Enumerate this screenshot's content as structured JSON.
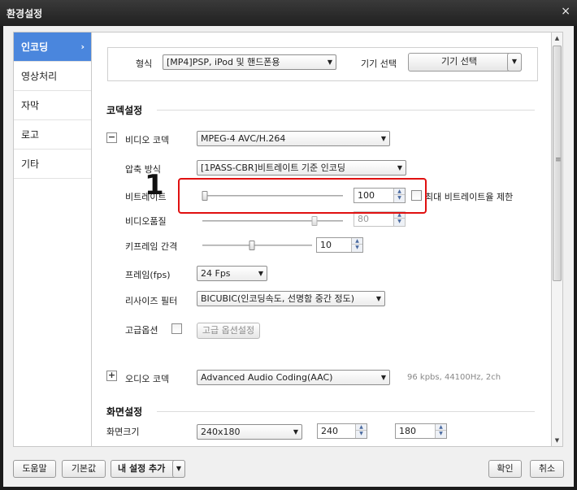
{
  "window": {
    "title": "환경설정",
    "close_glyph": "×"
  },
  "sidebar": {
    "items": [
      {
        "label": "인코딩",
        "active": true,
        "chevron": "›"
      },
      {
        "label": "영상처리"
      },
      {
        "label": "자막"
      },
      {
        "label": "로고"
      },
      {
        "label": "기타"
      }
    ]
  },
  "format": {
    "label": "형식",
    "value": "[MP4]PSP, iPod 및 핸드폰용",
    "device_label": "기기 선택",
    "device_button": "기기 선택"
  },
  "codec": {
    "heading": "코덱설정",
    "video_codec_label": "비디오 코덱",
    "video_codec_value": "MPEG-4 AVC/H.264",
    "compression_label": "압축 방식",
    "compression_value": "[1PASS-CBR]비트레이트 기준 인코딩",
    "bitrate_label": "비트레이트",
    "bitrate_value": "100",
    "bitrate_slider_fraction": 0.02,
    "max_bitrate_label": "최대 비트레이트율 제한",
    "max_bitrate_checked": false,
    "quality_label": "비디오품질",
    "quality_value": "80",
    "quality_slider_fraction": 0.8,
    "keyframe_label": "키프레임 간격",
    "keyframe_value": "10",
    "keyframe_slider_fraction": 0.45,
    "fps_label": "프레임(fps)",
    "fps_value": "24 Fps",
    "resize_label": "리사이즈 필터",
    "resize_value": "BICUBIC(인코딩속도, 선명함 중간 정도)",
    "advanced_label": "고급옵션",
    "advanced_checked": false,
    "advanced_button": "고급 옵션설정",
    "audio_codec_label": "오디오 코덱",
    "audio_codec_value": "Advanced Audio Coding(AAC)",
    "audio_hint": "96 kpbs, 44100Hz, 2ch"
  },
  "screen": {
    "heading": "화면설정",
    "size_label": "화면크기",
    "size_value": "240x180",
    "width_value": "240",
    "height_value": "180"
  },
  "annotation": {
    "number": "1"
  },
  "footer": {
    "help": "도움말",
    "default": "기본값",
    "add_preset": "내 설정 추가",
    "ok": "확인",
    "cancel": "취소"
  },
  "glyphs": {
    "dropdown": "▼",
    "up": "▲",
    "down": "▼",
    "minus": "−",
    "plus": "+",
    "grip": "≡"
  }
}
